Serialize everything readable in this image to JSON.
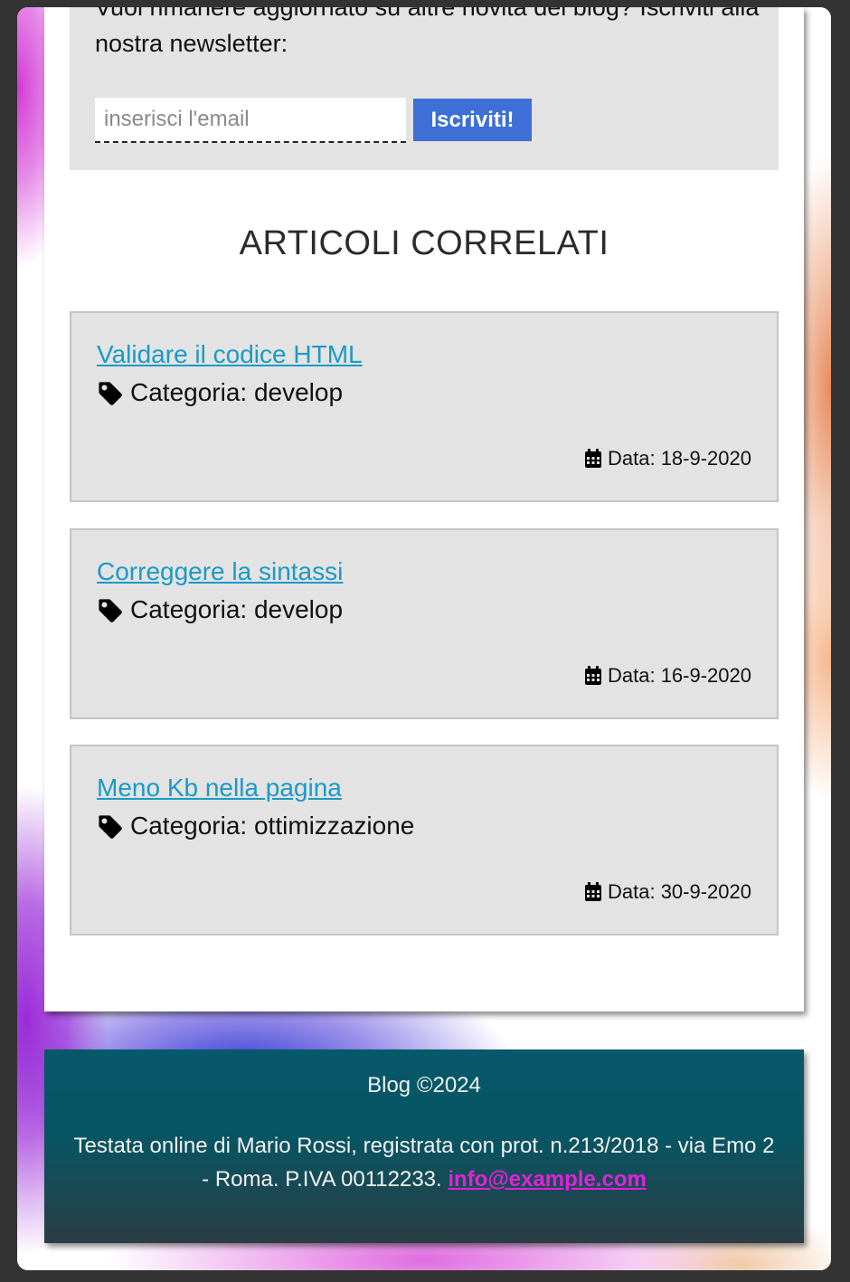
{
  "newsletter": {
    "text": "Vuoi rimanere aggiornato su altre novità del blog? Iscriviti alla nostra newsletter:",
    "email_placeholder": "inserisci l'email",
    "subscribe_label": "Iscriviti!"
  },
  "related": {
    "title": "ARTICOLI CORRELATI",
    "articles": [
      {
        "title": "Validare il codice HTML",
        "category": "Categoria: develop",
        "date": "Data: 18-9-2020"
      },
      {
        "title": "Correggere la sintassi",
        "category": "Categoria: develop",
        "date": "Data: 16-9-2020"
      },
      {
        "title": "Meno Kb nella pagina",
        "category": "Categoria: ottimizzazione",
        "date": "Data: 30-9-2020"
      }
    ]
  },
  "footer": {
    "copyright": "Blog ©2024",
    "info": "Testata online di Mario Rossi, registrata con prot. n.213/2018 - via Emo 2 - Roma. P.IVA 00112233.",
    "email": "info@example.com"
  },
  "colors": {
    "link": "#1a9ac6",
    "button": "#3d6fd6",
    "footer_bg": "#06596a",
    "footer_link": "#e421d8"
  },
  "icons": {
    "tag": "tag-icon",
    "calendar": "calendar-icon"
  }
}
